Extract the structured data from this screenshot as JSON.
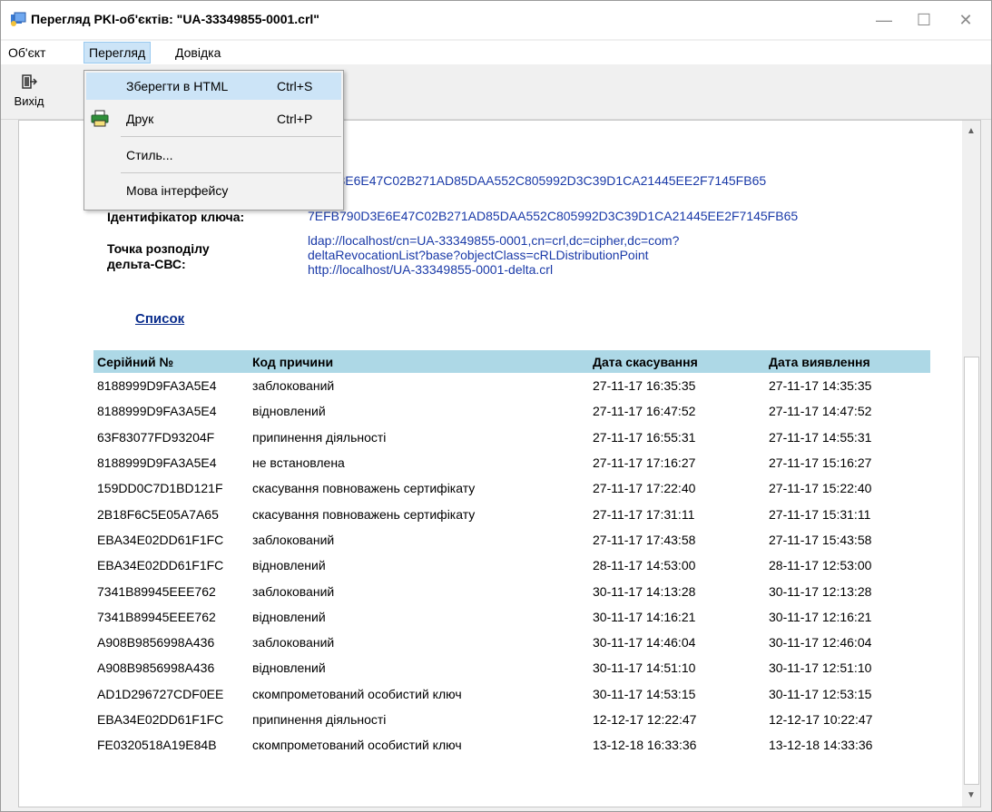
{
  "window": {
    "title": "Перегляд PKI-об'єктів: \"UA-33349855-0001.crl\"",
    "minimize": "—",
    "maximize": "☐",
    "close": "✕"
  },
  "menubar": {
    "items": [
      "Об'єкт",
      "Перегляд",
      "Довідка"
    ]
  },
  "dropdown": {
    "items": [
      {
        "label": "Зберегти в HTML",
        "shortcut": "Ctrl+S"
      },
      {
        "label": "Друк",
        "shortcut": "Ctrl+P"
      },
      {
        "label": "Стиль...",
        "shortcut": ""
      },
      {
        "label": "Мова інтерфейсу",
        "shortcut": ""
      }
    ]
  },
  "toolbar": {
    "exit_label": "Вихід"
  },
  "fields": {
    "partial_value": "790D3E6E47C02B271AD85DAA552C805992D3C39D1CA21445EE2F7145FB65",
    "key_id_label": "Ідентифікатор ключа:",
    "key_id_value": "7EFB790D3E6E47C02B271AD85DAA552C805992D3C39D1CA21445EE2F7145FB65",
    "delta_label_1": "Точка розподілу",
    "delta_label_2": "дельта-СВС:",
    "delta_value_1": "ldap://localhost/cn=UA-33349855-0001,cn=crl,dc=cipher,dc=com?",
    "delta_value_2": "deltaRevocationList?base?objectClass=cRLDistributionPoint",
    "delta_value_3": "http://localhost/UA-33349855-0001-delta.crl"
  },
  "list_link": "Список",
  "table": {
    "headers": [
      "Серійний №",
      "Код причини",
      "Дата скасування",
      "Дата виявлення"
    ],
    "rows": [
      [
        "8188999D9FA3A5E4",
        "заблокований",
        "27-11-17 16:35:35",
        "27-11-17 14:35:35"
      ],
      [
        "8188999D9FA3A5E4",
        "відновлений",
        "27-11-17 16:47:52",
        "27-11-17 14:47:52"
      ],
      [
        "63F83077FD93204F",
        "припинення діяльності",
        "27-11-17 16:55:31",
        "27-11-17 14:55:31"
      ],
      [
        "8188999D9FA3A5E4",
        "не встановлена",
        "27-11-17 17:16:27",
        "27-11-17 15:16:27"
      ],
      [
        "159DD0C7D1BD121F",
        "скасування повноважень сертифікату",
        "27-11-17 17:22:40",
        "27-11-17 15:22:40"
      ],
      [
        "2B18F6C5E05A7A65",
        "скасування повноважень сертифікату",
        "27-11-17 17:31:11",
        "27-11-17 15:31:11"
      ],
      [
        "EBA34E02DD61F1FC",
        "заблокований",
        "27-11-17 17:43:58",
        "27-11-17 15:43:58"
      ],
      [
        "EBA34E02DD61F1FC",
        "відновлений",
        "28-11-17 14:53:00",
        "28-11-17 12:53:00"
      ],
      [
        "7341B89945EEE762",
        "заблокований",
        "30-11-17 14:13:28",
        "30-11-17 12:13:28"
      ],
      [
        "7341B89945EEE762",
        "відновлений",
        "30-11-17 14:16:21",
        "30-11-17 12:16:21"
      ],
      [
        "A908B9856998A436",
        "заблокований",
        "30-11-17 14:46:04",
        "30-11-17 12:46:04"
      ],
      [
        "A908B9856998A436",
        "відновлений",
        "30-11-17 14:51:10",
        "30-11-17 12:51:10"
      ],
      [
        "AD1D296727CDF0EE",
        "скомпрометований особистий ключ",
        "30-11-17 14:53:15",
        "30-11-17 12:53:15"
      ],
      [
        "EBA34E02DD61F1FC",
        "припинення діяльності",
        "12-12-17 12:22:47",
        "12-12-17 10:22:47"
      ],
      [
        "FE0320518A19E84B",
        "скомпрометований особистий ключ",
        "13-12-18 16:33:36",
        "13-12-18 14:33:36"
      ]
    ]
  },
  "colors": {
    "header_bg": "#add8e6",
    "link": "#1a3aa8",
    "menu_highlight": "#cce4f7"
  }
}
